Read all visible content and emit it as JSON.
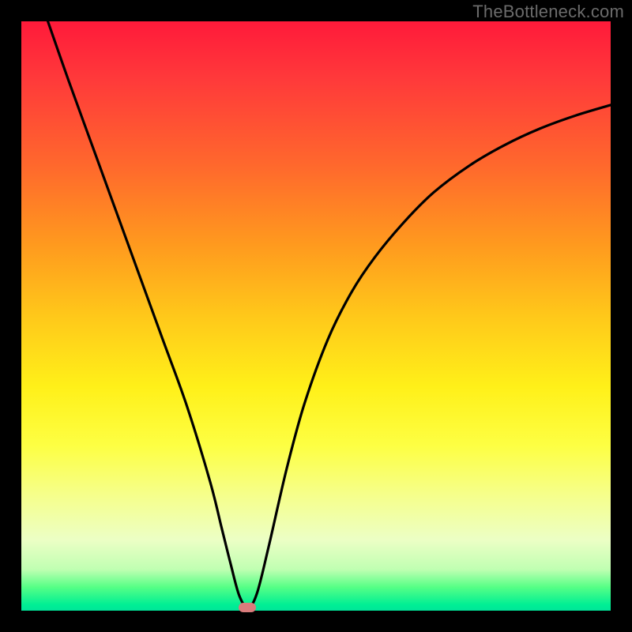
{
  "watermark": "TheBottleneck.com",
  "chart_data": {
    "type": "line",
    "title": "",
    "xlabel": "",
    "ylabel": "",
    "xlim": [
      0,
      100
    ],
    "ylim": [
      0,
      100
    ],
    "grid": false,
    "series": [
      {
        "name": "bottleneck-curve",
        "x": [
          4.5,
          8,
          12,
          16,
          20,
          24,
          28,
          32,
          34,
          35.5,
          37,
          38.5,
          40,
          42,
          45,
          48,
          52,
          56,
          60,
          65,
          70,
          76,
          82,
          88,
          94,
          100
        ],
        "y": [
          100,
          90,
          79,
          68,
          57,
          46,
          35,
          22,
          14,
          8,
          2.5,
          0.5,
          3,
          11,
          24,
          35,
          46,
          54,
          60,
          66,
          71,
          75.5,
          79,
          81.8,
          84,
          85.8
        ]
      }
    ],
    "annotations": [
      {
        "name": "min-marker",
        "x": 38.3,
        "y": 0.5
      }
    ],
    "background": {
      "type": "vertical-gradient",
      "stops": [
        {
          "pos": 0,
          "color": "#ff1a3a"
        },
        {
          "pos": 50,
          "color": "#ffc81a"
        },
        {
          "pos": 80,
          "color": "#f6ff88"
        },
        {
          "pos": 100,
          "color": "#00e599"
        }
      ]
    }
  },
  "colors": {
    "frame": "#000000",
    "curve": "#000000",
    "marker": "#d97c7c",
    "watermark": "#6b6b6b"
  }
}
